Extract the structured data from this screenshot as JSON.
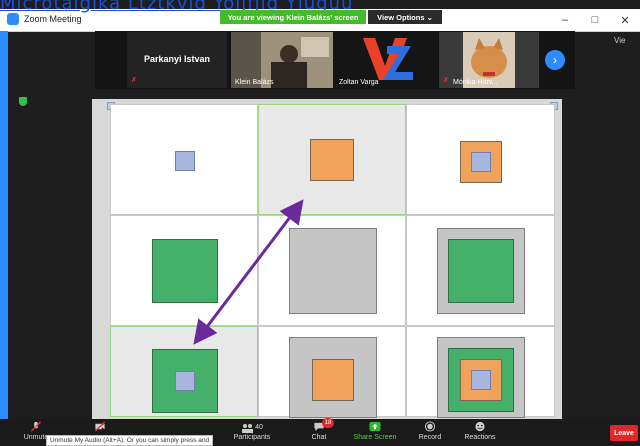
{
  "overlay": {
    "link_text": "Microtalgika Ltztkvid Yoljfjld Yluguu"
  },
  "window": {
    "title": "Zoom Meeting",
    "minimize": "–",
    "maximize": "□",
    "close": "✕"
  },
  "banner": {
    "viewing": "You are viewing Klein Balázs' screen",
    "view_options": "View Options ⌄"
  },
  "gallery": {
    "tiles": [
      {
        "name": "Parkanyi Istvan",
        "muted": true
      },
      {
        "name": "Klein Balázs",
        "muted": false
      },
      {
        "name": "Zoltan Varga",
        "muted": false
      },
      {
        "name": "Mónika Horv...",
        "muted": true
      }
    ],
    "view_label": "Vie"
  },
  "toolbar": {
    "unmute": "Unmute",
    "tooltip": "Unmute My Audio (Alt+A). Or you can simply press and",
    "participants_count": "40",
    "participants": "Participants",
    "chat": "Chat",
    "chat_badge": "18",
    "share": "Share Screen",
    "record": "Record",
    "reactions": "Reactions",
    "leave": "Leave"
  },
  "colors": {
    "accent": "#2d8cff",
    "share_green": "#44bb2a",
    "leave_red": "#e02828"
  },
  "board": {
    "grid": "3x3",
    "cells": [
      {
        "outer": null,
        "middle": null,
        "inner": "blue",
        "highlight": false
      },
      {
        "outer": null,
        "middle": null,
        "inner": "orange",
        "highlight": true
      },
      {
        "outer": null,
        "middle": "orange",
        "inner": "blue",
        "highlight": false
      },
      {
        "outer": null,
        "middle": null,
        "inner": "green",
        "highlight": false
      },
      {
        "outer": null,
        "middle": null,
        "inner": "gray",
        "highlight": false
      },
      {
        "outer": "gray",
        "middle": null,
        "inner": "green",
        "highlight": false
      },
      {
        "outer": null,
        "middle": "green",
        "inner": "blue",
        "highlight": true
      },
      {
        "outer": "gray",
        "middle": null,
        "inner": "orange",
        "highlight": false
      },
      {
        "outer": "gray",
        "middle": "green",
        "inner": "orange",
        "innermost": "blue",
        "highlight": false
      }
    ],
    "arrow": "bidirectional purple arrow between cell 2 and cell 7"
  }
}
